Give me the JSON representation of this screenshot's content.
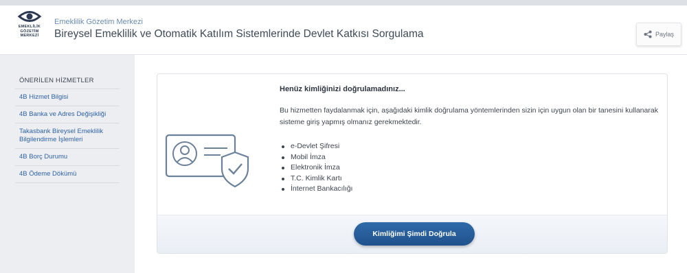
{
  "header": {
    "logo": {
      "icon": "eye-logo-icon",
      "text": "EMEKLİLİK\nGÖZETİM\nMERKEZİ"
    },
    "site_name": "Emeklilik Gözetim Merkezi",
    "page_title": "Bireysel Emeklilik ve Otomatik Katılım Sistemlerinde Devlet Katkısı Sorgulama",
    "share": {
      "icon": "share-icon",
      "label": "Paylaş"
    }
  },
  "sidebar": {
    "heading": "ÖNERİLEN HİZMETLER",
    "items": [
      {
        "label": "4B Hizmet Bilgisi"
      },
      {
        "label": "4B Banka ve Adres Değişikliği"
      },
      {
        "label": "Takasbank Bireysel Emeklilik Bilgilendirme İşlemleri"
      },
      {
        "label": "4B Borç Durumu"
      },
      {
        "label": "4B Ödeme Dökümü"
      }
    ]
  },
  "card": {
    "illustration_icon": "id-card-shield-icon",
    "title": "Henüz kimliğinizi doğrulamadınız...",
    "description": "Bu hizmetten faydalanmak için, aşağıdaki kimlik doğrulama yöntemlerinden sizin için uygun olan bir tanesini kullanarak sisteme giriş yapmış olmanız gerekmektedir.",
    "methods": [
      "e-Devlet Şifresi",
      "Mobil İmza",
      "Elektronik İmza",
      "T.C. Kimlik Kartı",
      "İnternet Bankacılığı"
    ],
    "button_label": "Kimliğimi Şimdi Doğrula"
  },
  "colors": {
    "accent": "#2f62a6",
    "button": "#25599a",
    "title_text": "#3e4a58",
    "sidebar_bg": "#eceef1"
  }
}
